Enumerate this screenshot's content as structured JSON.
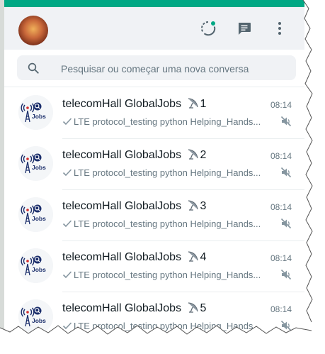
{
  "search": {
    "placeholder": "Pesquisar ou começar uma nova conversa"
  },
  "chats": [
    {
      "name": "telecomHall GlobalJobs",
      "suffix": "1",
      "time": "08:14",
      "preview": "LTE protocol_testing python Helping_Hands..."
    },
    {
      "name": "telecomHall GlobalJobs",
      "suffix": "2",
      "time": "08:14",
      "preview": "LTE protocol_testing python Helping_Hands..."
    },
    {
      "name": "telecomHall GlobalJobs",
      "suffix": "3",
      "time": "08:14",
      "preview": "LTE protocol_testing python Helping_Hands..."
    },
    {
      "name": "telecomHall GlobalJobs",
      "suffix": "4",
      "time": "08:14",
      "preview": "LTE protocol_testing python Helping_Hands..."
    },
    {
      "name": "telecomHall GlobalJobs",
      "suffix": "5",
      "time": "08:14",
      "preview": "LTE protocol_testing python Helping_Hands..."
    }
  ],
  "jobs_logo_text": "Jobs",
  "icons": {
    "status": "status-ring-icon",
    "new_chat": "message-square-icon",
    "menu": "three-dots-vertical-icon",
    "search": "search-icon",
    "sent": "single-check-icon",
    "muted": "muted-speaker-icon",
    "satellite": "satellite-dish-icon"
  },
  "colors": {
    "accent": "#00a884",
    "header_bg": "#f0f2f5",
    "text_primary": "#111b21",
    "text_secondary": "#667781"
  }
}
